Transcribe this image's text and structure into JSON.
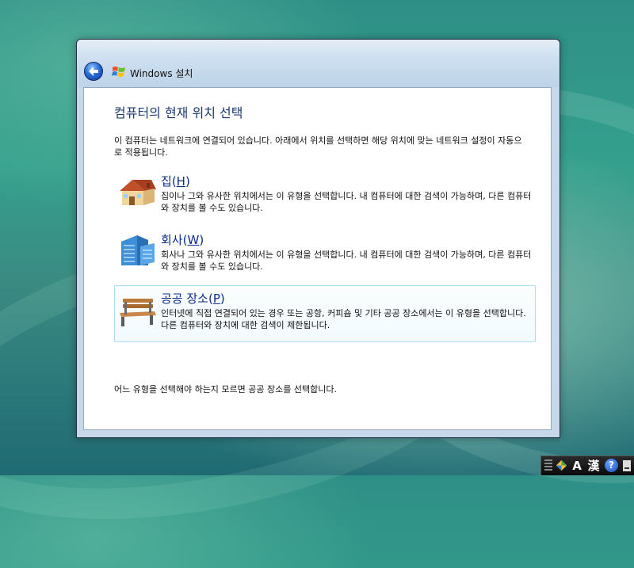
{
  "window": {
    "title": "Windows 설치",
    "back_label": "뒤로"
  },
  "page": {
    "heading": "컴퓨터의 현재 위치 선택",
    "intro": "이 컴퓨터는 네트워크에 연결되어 있습니다. 아래에서 위치를 선택하면 해당 위치에 맞는 네트워크 설정이 자동으로 적용됩니다.",
    "footer_note": "어느 유형을 선택해야 하는지 모르면 공공 장소를 선택합니다."
  },
  "options": [
    {
      "name": "집",
      "mnemonic": "H",
      "description": "집이나 그와 유사한 위치에서는 이 유형을 선택합니다. 내 컴퓨터에 대한 검색이 가능하며, 다른 컴퓨터와 장치를 볼 수도 있습니다.",
      "icon": "house-icon",
      "selected": false
    },
    {
      "name": "회사",
      "mnemonic": "W",
      "description": "회사나 그와 유사한 위치에서는 이 유형을 선택합니다. 내 컴퓨터에 대한 검색이 가능하며, 다른 컴퓨터와 장치를 볼 수도 있습니다.",
      "icon": "office-building-icon",
      "selected": false
    },
    {
      "name": "공공 장소",
      "mnemonic": "P",
      "description": "인터넷에 직접 연결되어 있는 경우 또는 공항, 커피숍 및 기타 공공 장소에서는 이 유형을 선택합니다. 다른 컴퓨터와 장치에 대한 검색이 제한됩니다.",
      "icon": "park-bench-icon",
      "selected": true
    }
  ],
  "language_bar": {
    "input_mode": "A",
    "hanja": "漢",
    "help": "?"
  },
  "colors": {
    "heading": "#1c3a6e",
    "option_title": "#0b2c8a",
    "selected_border": "#a9dfee"
  }
}
